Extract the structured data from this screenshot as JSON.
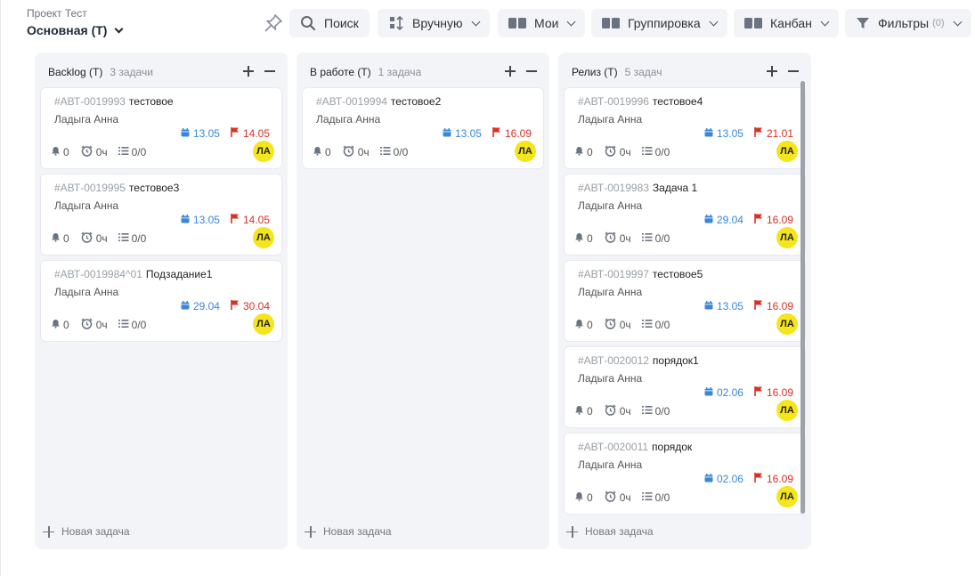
{
  "project": {
    "name": "Проект Тест",
    "board": "Основная (Т)"
  },
  "toolbar": {
    "search": "Поиск",
    "sort": "Вручную",
    "mine": "Мои",
    "grouping": "Группировка",
    "view": "Канбан",
    "filters": "Фильтры",
    "filters_count": "(0)"
  },
  "new_task_label": "Новая задача",
  "columns": [
    {
      "title": "Backlog (Т)",
      "count": "3 задачи",
      "cards": [
        {
          "code": "#АВТ-0019993",
          "title": "тестовое",
          "assignee": "Ладыга Анна",
          "start": "13.05",
          "end": "14.05",
          "notifications": "0",
          "time": "0ч",
          "checklist": "0/0",
          "initials": "ЛА"
        },
        {
          "code": "#АВТ-0019995",
          "title": "тестовое3",
          "assignee": "Ладыга Анна",
          "start": "13.05",
          "end": "14.05",
          "notifications": "0",
          "time": "0ч",
          "checklist": "0/0",
          "initials": "ЛА"
        },
        {
          "code": "#АВТ-0019984^01",
          "title": "Подзадание1",
          "assignee": "Ладыга Анна",
          "start": "29.04",
          "end": "30.04",
          "notifications": "0",
          "time": "0ч",
          "checklist": "0/0",
          "initials": "ЛА"
        }
      ]
    },
    {
      "title": "В работе (Т)",
      "count": "1 задача",
      "cards": [
        {
          "code": "#АВТ-0019994",
          "title": "тестовое2",
          "assignee": "Ладыга Анна",
          "start": "13.05",
          "end": "16.09",
          "notifications": "0",
          "time": "0ч",
          "checklist": "0/0",
          "initials": "ЛА"
        }
      ]
    },
    {
      "title": "Релиз (Т)",
      "count": "5 задач",
      "cards": [
        {
          "code": "#АВТ-0019996",
          "title": "тестовое4",
          "assignee": "Ладыга Анна",
          "start": "13.05",
          "end": "21.01",
          "notifications": "0",
          "time": "0ч",
          "checklist": "0/0",
          "initials": "ЛА"
        },
        {
          "code": "#АВТ-0019983",
          "title": "Задача 1",
          "assignee": "Ладыга Анна",
          "start": "29.04",
          "end": "16.09",
          "notifications": "0",
          "time": "0ч",
          "checklist": "0/0",
          "initials": "ЛА"
        },
        {
          "code": "#АВТ-0019997",
          "title": "тестовое5",
          "assignee": "Ладыга Анна",
          "start": "13.05",
          "end": "16.09",
          "notifications": "0",
          "time": "0ч",
          "checklist": "0/0",
          "initials": "ЛА"
        },
        {
          "code": "#АВТ-0020012",
          "title": "порядок1",
          "assignee": "Ладыга Анна",
          "start": "02.06",
          "end": "16.09",
          "notifications": "0",
          "time": "0ч",
          "checklist": "0/0",
          "initials": "ЛА"
        },
        {
          "code": "#АВТ-0020011",
          "title": "порядок",
          "assignee": "Ладыга Анна",
          "start": "02.06",
          "end": "16.09",
          "notifications": "0",
          "time": "0ч",
          "checklist": "0/0",
          "initials": "ЛА"
        }
      ]
    }
  ],
  "colors": {
    "accent": "#3a87d8",
    "deadline": "#d93025",
    "avatar": "#f5e51c",
    "column_bg": "#f2f4f8"
  }
}
